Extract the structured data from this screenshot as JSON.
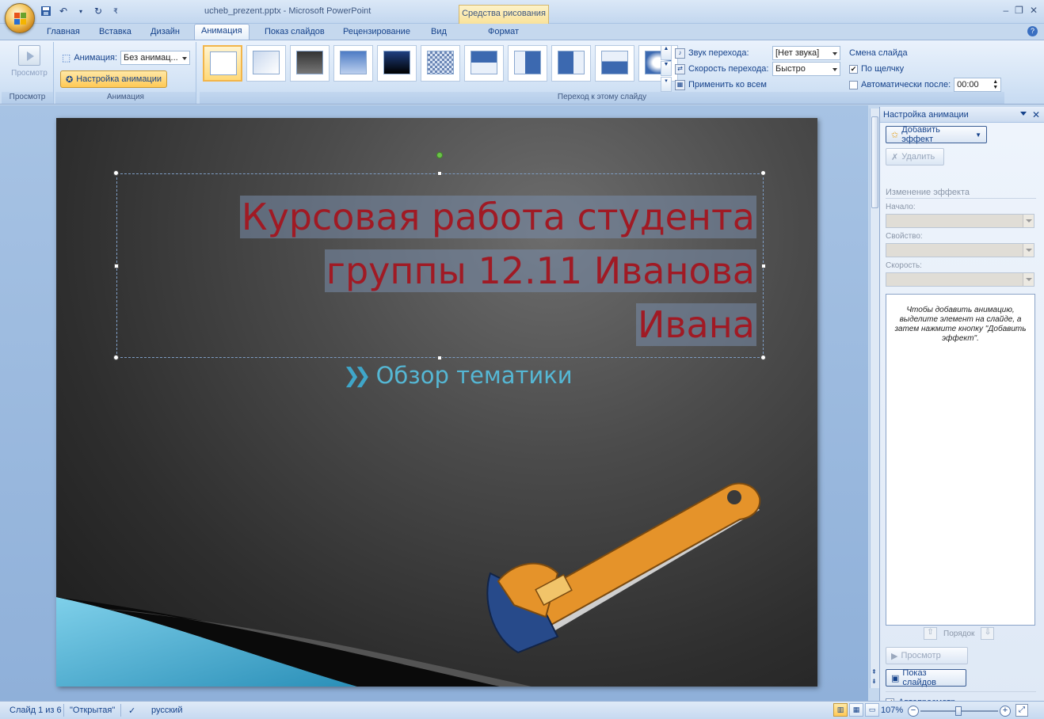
{
  "window": {
    "title": "ucheb_prezent.pptx - Microsoft PowerPoint",
    "context_tab_header": "Средства рисования",
    "controls": [
      "–",
      "❐",
      "✕"
    ]
  },
  "tabs": [
    {
      "label": "Главная",
      "active": false
    },
    {
      "label": "Вставка",
      "active": false
    },
    {
      "label": "Дизайн",
      "active": false
    },
    {
      "label": "Анимация",
      "active": true
    },
    {
      "label": "Показ слайдов",
      "active": false
    },
    {
      "label": "Рецензирование",
      "active": false
    },
    {
      "label": "Вид",
      "active": false
    },
    {
      "label": "Формат",
      "active": false
    }
  ],
  "ribbon": {
    "preview_group": {
      "button_label": "Просмотр",
      "group_label": "Просмотр"
    },
    "animation_group": {
      "animation_label": "Анимация:",
      "animation_value": "Без анимац...",
      "custom_animation_label": "Настройка анимации",
      "group_label": "Анимация"
    },
    "transition_group": {
      "group_label": "Переход к этому слайду",
      "sound_label": "Звук перехода:",
      "sound_value": "[Нет звука]",
      "speed_label": "Скорость перехода:",
      "speed_value": "Быстро",
      "apply_all_label": "Применить ко всем"
    },
    "slide_change": {
      "title": "Смена слайда",
      "on_click_label": "По щелчку",
      "on_click_checked": true,
      "auto_after_label": "Автоматически после:",
      "auto_after_checked": false,
      "auto_after_value": "00:00"
    }
  },
  "slide": {
    "title_lines": [
      "Курсовая работа студента",
      "группы 12.11 Иванова",
      "Ивана"
    ],
    "subtitle": "Обзор тематики",
    "title_color": "#a01a24",
    "subtitle_color": "#55b7d4"
  },
  "task_pane": {
    "title": "Настройка анимации",
    "add_effect_label": "Добавить эффект",
    "remove_label": "Удалить",
    "change_effect_title": "Изменение эффекта",
    "start_label": "Начало:",
    "property_label": "Свойство:",
    "speed_label": "Скорость:",
    "hint_text": "Чтобы добавить анимацию, выделите элемент на слайде, а затем нажмите кнопку \"Добавить эффект\".",
    "order_label": "Порядок",
    "preview_label": "Просмотр",
    "slideshow_label": "Показ слайдов",
    "autopreview_label": "Автопросмотр",
    "autopreview_checked": true
  },
  "statusbar": {
    "slide_info": "Слайд 1 из 6",
    "theme": "\"Открытая\"",
    "language": "русский",
    "zoom": "107%"
  }
}
